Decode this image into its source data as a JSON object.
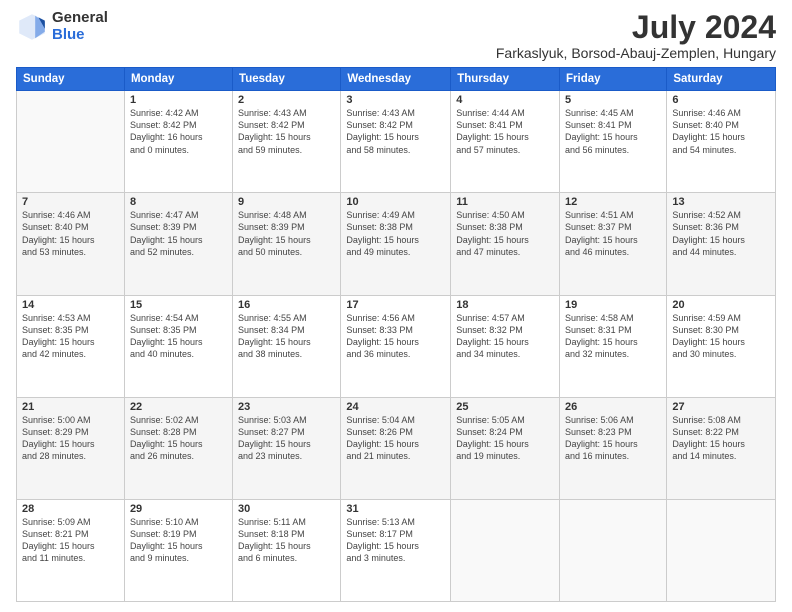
{
  "logo": {
    "general": "General",
    "blue": "Blue"
  },
  "title": "July 2024",
  "subtitle": "Farkaslyuk, Borsod-Abauj-Zemplen, Hungary",
  "headers": [
    "Sunday",
    "Monday",
    "Tuesday",
    "Wednesday",
    "Thursday",
    "Friday",
    "Saturday"
  ],
  "weeks": [
    [
      {
        "day": "",
        "info": ""
      },
      {
        "day": "1",
        "info": "Sunrise: 4:42 AM\nSunset: 8:42 PM\nDaylight: 16 hours\nand 0 minutes."
      },
      {
        "day": "2",
        "info": "Sunrise: 4:43 AM\nSunset: 8:42 PM\nDaylight: 15 hours\nand 59 minutes."
      },
      {
        "day": "3",
        "info": "Sunrise: 4:43 AM\nSunset: 8:42 PM\nDaylight: 15 hours\nand 58 minutes."
      },
      {
        "day": "4",
        "info": "Sunrise: 4:44 AM\nSunset: 8:41 PM\nDaylight: 15 hours\nand 57 minutes."
      },
      {
        "day": "5",
        "info": "Sunrise: 4:45 AM\nSunset: 8:41 PM\nDaylight: 15 hours\nand 56 minutes."
      },
      {
        "day": "6",
        "info": "Sunrise: 4:46 AM\nSunset: 8:40 PM\nDaylight: 15 hours\nand 54 minutes."
      }
    ],
    [
      {
        "day": "7",
        "info": "Sunrise: 4:46 AM\nSunset: 8:40 PM\nDaylight: 15 hours\nand 53 minutes."
      },
      {
        "day": "8",
        "info": "Sunrise: 4:47 AM\nSunset: 8:39 PM\nDaylight: 15 hours\nand 52 minutes."
      },
      {
        "day": "9",
        "info": "Sunrise: 4:48 AM\nSunset: 8:39 PM\nDaylight: 15 hours\nand 50 minutes."
      },
      {
        "day": "10",
        "info": "Sunrise: 4:49 AM\nSunset: 8:38 PM\nDaylight: 15 hours\nand 49 minutes."
      },
      {
        "day": "11",
        "info": "Sunrise: 4:50 AM\nSunset: 8:38 PM\nDaylight: 15 hours\nand 47 minutes."
      },
      {
        "day": "12",
        "info": "Sunrise: 4:51 AM\nSunset: 8:37 PM\nDaylight: 15 hours\nand 46 minutes."
      },
      {
        "day": "13",
        "info": "Sunrise: 4:52 AM\nSunset: 8:36 PM\nDaylight: 15 hours\nand 44 minutes."
      }
    ],
    [
      {
        "day": "14",
        "info": "Sunrise: 4:53 AM\nSunset: 8:35 PM\nDaylight: 15 hours\nand 42 minutes."
      },
      {
        "day": "15",
        "info": "Sunrise: 4:54 AM\nSunset: 8:35 PM\nDaylight: 15 hours\nand 40 minutes."
      },
      {
        "day": "16",
        "info": "Sunrise: 4:55 AM\nSunset: 8:34 PM\nDaylight: 15 hours\nand 38 minutes."
      },
      {
        "day": "17",
        "info": "Sunrise: 4:56 AM\nSunset: 8:33 PM\nDaylight: 15 hours\nand 36 minutes."
      },
      {
        "day": "18",
        "info": "Sunrise: 4:57 AM\nSunset: 8:32 PM\nDaylight: 15 hours\nand 34 minutes."
      },
      {
        "day": "19",
        "info": "Sunrise: 4:58 AM\nSunset: 8:31 PM\nDaylight: 15 hours\nand 32 minutes."
      },
      {
        "day": "20",
        "info": "Sunrise: 4:59 AM\nSunset: 8:30 PM\nDaylight: 15 hours\nand 30 minutes."
      }
    ],
    [
      {
        "day": "21",
        "info": "Sunrise: 5:00 AM\nSunset: 8:29 PM\nDaylight: 15 hours\nand 28 minutes."
      },
      {
        "day": "22",
        "info": "Sunrise: 5:02 AM\nSunset: 8:28 PM\nDaylight: 15 hours\nand 26 minutes."
      },
      {
        "day": "23",
        "info": "Sunrise: 5:03 AM\nSunset: 8:27 PM\nDaylight: 15 hours\nand 23 minutes."
      },
      {
        "day": "24",
        "info": "Sunrise: 5:04 AM\nSunset: 8:26 PM\nDaylight: 15 hours\nand 21 minutes."
      },
      {
        "day": "25",
        "info": "Sunrise: 5:05 AM\nSunset: 8:24 PM\nDaylight: 15 hours\nand 19 minutes."
      },
      {
        "day": "26",
        "info": "Sunrise: 5:06 AM\nSunset: 8:23 PM\nDaylight: 15 hours\nand 16 minutes."
      },
      {
        "day": "27",
        "info": "Sunrise: 5:08 AM\nSunset: 8:22 PM\nDaylight: 15 hours\nand 14 minutes."
      }
    ],
    [
      {
        "day": "28",
        "info": "Sunrise: 5:09 AM\nSunset: 8:21 PM\nDaylight: 15 hours\nand 11 minutes."
      },
      {
        "day": "29",
        "info": "Sunrise: 5:10 AM\nSunset: 8:19 PM\nDaylight: 15 hours\nand 9 minutes."
      },
      {
        "day": "30",
        "info": "Sunrise: 5:11 AM\nSunset: 8:18 PM\nDaylight: 15 hours\nand 6 minutes."
      },
      {
        "day": "31",
        "info": "Sunrise: 5:13 AM\nSunset: 8:17 PM\nDaylight: 15 hours\nand 3 minutes."
      },
      {
        "day": "",
        "info": ""
      },
      {
        "day": "",
        "info": ""
      },
      {
        "day": "",
        "info": ""
      }
    ]
  ]
}
